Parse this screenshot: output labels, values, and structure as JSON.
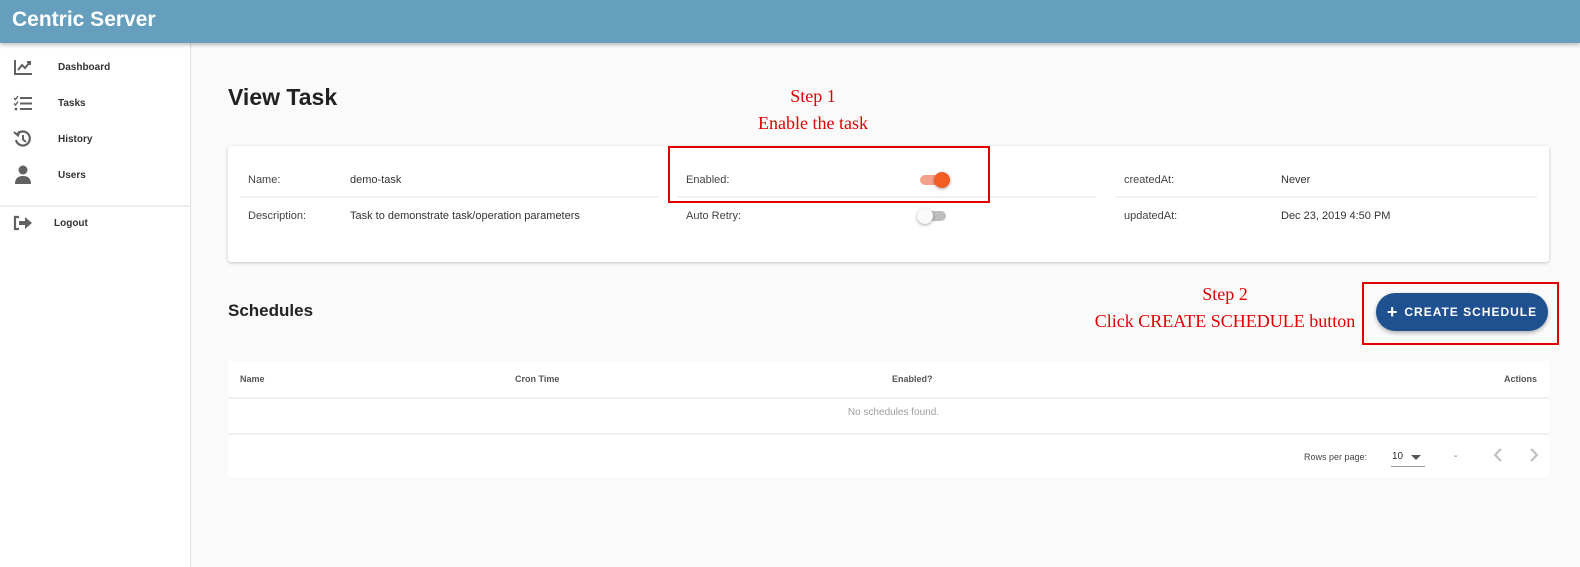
{
  "app": {
    "title": "Centric Server"
  },
  "sidebar": {
    "items": [
      {
        "label": "Dashboard",
        "icon": "chart-line-icon"
      },
      {
        "label": "Tasks",
        "icon": "checklist-icon"
      },
      {
        "label": "History",
        "icon": "history-icon"
      },
      {
        "label": "Users",
        "icon": "person-icon"
      }
    ],
    "logout": {
      "label": "Logout",
      "icon": "logout-icon"
    }
  },
  "page": {
    "title": "View Task"
  },
  "task": {
    "name_label": "Name:",
    "name_value": "demo-task",
    "description_label": "Description:",
    "description_value": "Task to demonstrate task/operation parameters",
    "enabled_label": "Enabled:",
    "enabled_value": true,
    "auto_retry_label": "Auto Retry:",
    "auto_retry_value": false,
    "created_label": "createdAt:",
    "created_value": "Never",
    "updated_label": "updatedAt:",
    "updated_value": "Dec 23, 2019 4:50 PM"
  },
  "annotations": {
    "step1_title": "Step 1",
    "step1_text": "Enable the task",
    "step2_title": "Step 2",
    "step2_text": "Click CREATE SCHEDULE button",
    "color": "#e00000"
  },
  "schedules": {
    "title": "Schedules",
    "create_button": "CREATE SCHEDULE",
    "columns": [
      "Name",
      "Cron Time",
      "Enabled?",
      "Actions"
    ],
    "empty_message": "No schedules found.",
    "pagination": {
      "rows_per_page_label": "Rows per page:",
      "rows_per_page_value": "10",
      "range": "-"
    }
  },
  "colors": {
    "appbar": "#669fbe",
    "primary_button": "#1f5190",
    "toggle_on": "#f25d24"
  }
}
